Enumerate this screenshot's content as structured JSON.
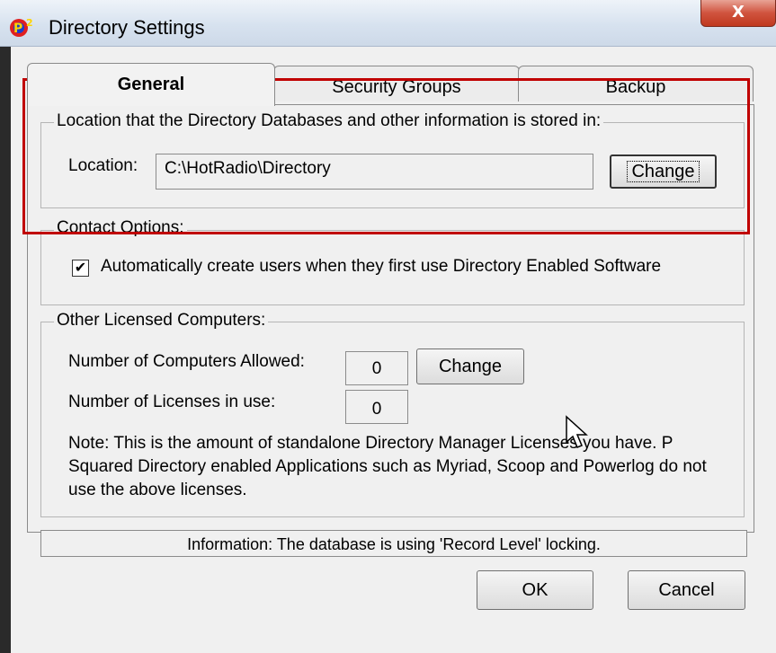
{
  "window": {
    "title": "Directory Settings",
    "close_label": "X"
  },
  "tabs": [
    {
      "label": "General",
      "active": true
    },
    {
      "label": "Security Groups",
      "active": false
    },
    {
      "label": "Backup",
      "active": false
    }
  ],
  "location_group": {
    "legend": "Location that the Directory Databases and other information is stored in:",
    "label": "Location:",
    "value": "C:\\HotRadio\\Directory",
    "change_label": "Change"
  },
  "contact_group": {
    "legend": "Contact Options:",
    "auto_create_checked": true,
    "auto_create_label": "Automatically create users when they first use Directory Enabled Software"
  },
  "licensed_group": {
    "legend": "Other Licensed Computers:",
    "computers_label": "Number of Computers Allowed:",
    "computers_value": "0",
    "change_label": "Change",
    "licenses_label": "Number of Licenses in use:",
    "licenses_value": "0",
    "note": "Note: This is the amount of standalone Directory Manager Licenses you have. P Squared Directory enabled Applications such as Myriad, Scoop and Powerlog do not use the above licenses."
  },
  "status": {
    "text": "Information: The database is using 'Record Level' locking."
  },
  "buttons": {
    "ok_label": "OK",
    "cancel_label": "Cancel"
  },
  "colors": {
    "highlight": "#c00000",
    "close_button": "#c0391f"
  },
  "icons": {
    "app": "p-squared-app-icon",
    "cursor": "mouse-pointer-icon",
    "check": "checkmark-icon"
  }
}
